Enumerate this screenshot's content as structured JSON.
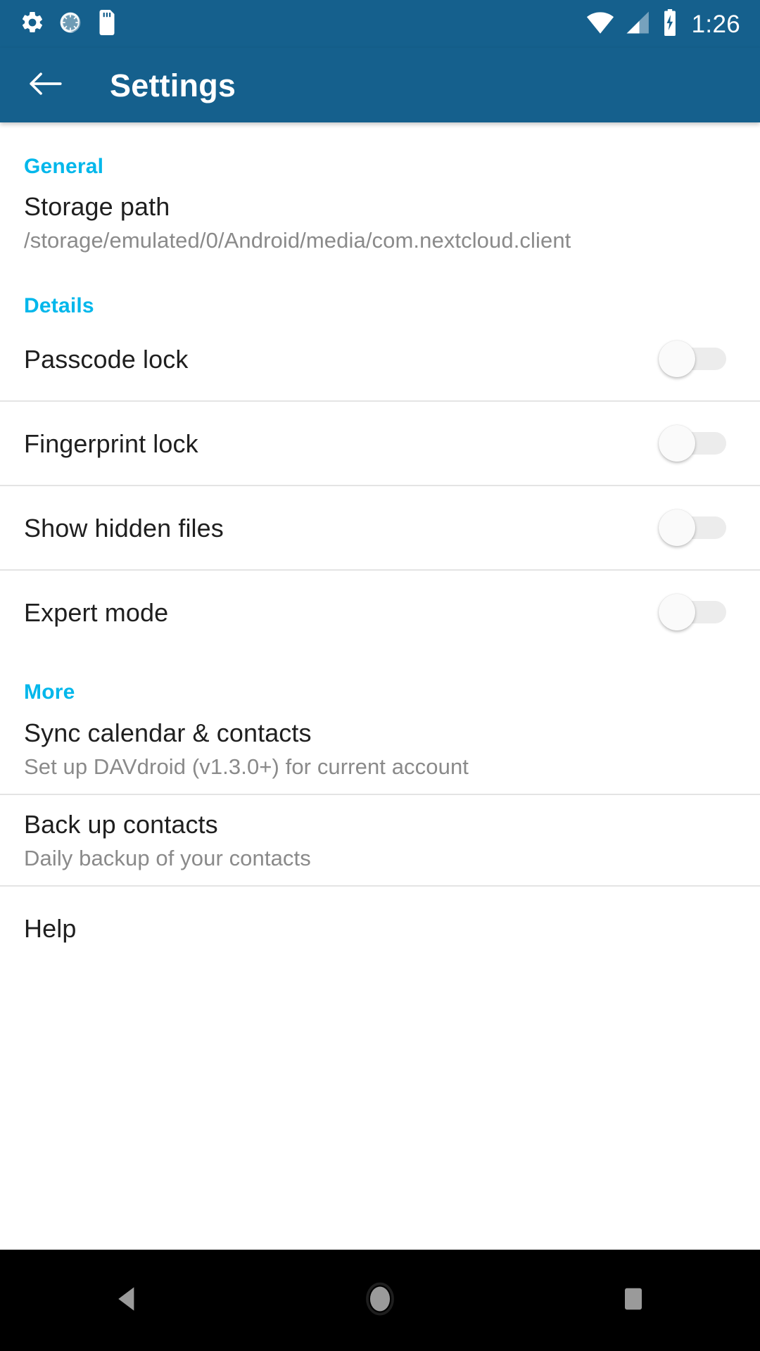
{
  "status_bar": {
    "icons_left": [
      "settings-gear-icon",
      "sync-progress-icon",
      "sd-card-icon"
    ],
    "icons_right": [
      "wifi-icon",
      "cellular-signal-icon",
      "battery-charging-icon"
    ],
    "clock": "1:26",
    "background_color": "#15608d"
  },
  "app_bar": {
    "back_icon": "arrow-left-icon",
    "title": "Settings",
    "background_color": "#15608d",
    "title_color": "#ffffff"
  },
  "theme": {
    "accent": "#00b7eb",
    "primary": "#15608d",
    "title_text": "#1f1f1f",
    "subtitle_text": "#8a8a8a",
    "divider": "#e4e4e4"
  },
  "sections": [
    {
      "id": "general",
      "header": "General",
      "items": [
        {
          "id": "storage-path",
          "title": "Storage path",
          "subtitle": "/storage/emulated/0/Android/media/com.nextcloud.client",
          "type": "text"
        }
      ]
    },
    {
      "id": "details",
      "header": "Details",
      "items": [
        {
          "id": "passcode-lock",
          "title": "Passcode lock",
          "type": "switch",
          "checked": false,
          "state_label": "off"
        },
        {
          "id": "fingerprint-lock",
          "title": "Fingerprint lock",
          "type": "switch",
          "checked": false,
          "state_label": "off"
        },
        {
          "id": "show-hidden-files",
          "title": "Show hidden files",
          "type": "switch",
          "checked": false,
          "state_label": "off"
        },
        {
          "id": "expert-mode",
          "title": "Expert mode",
          "type": "switch",
          "checked": false,
          "state_label": "off"
        }
      ]
    },
    {
      "id": "more",
      "header": "More",
      "items": [
        {
          "id": "sync-calendar-contacts",
          "title": "Sync calendar & contacts",
          "subtitle": "Set up DAVdroid (v1.3.0+) for current account",
          "type": "text"
        },
        {
          "id": "back-up-contacts",
          "title": "Back up contacts",
          "subtitle": "Daily backup of your contacts",
          "type": "text"
        },
        {
          "id": "help",
          "title": "Help",
          "subtitle": "",
          "type": "text"
        }
      ]
    }
  ],
  "nav_bar": {
    "back_icon": "nav-back-triangle-icon",
    "home_icon": "nav-home-circle-icon",
    "recents_icon": "nav-recents-square-icon",
    "background_color": "#000000"
  }
}
